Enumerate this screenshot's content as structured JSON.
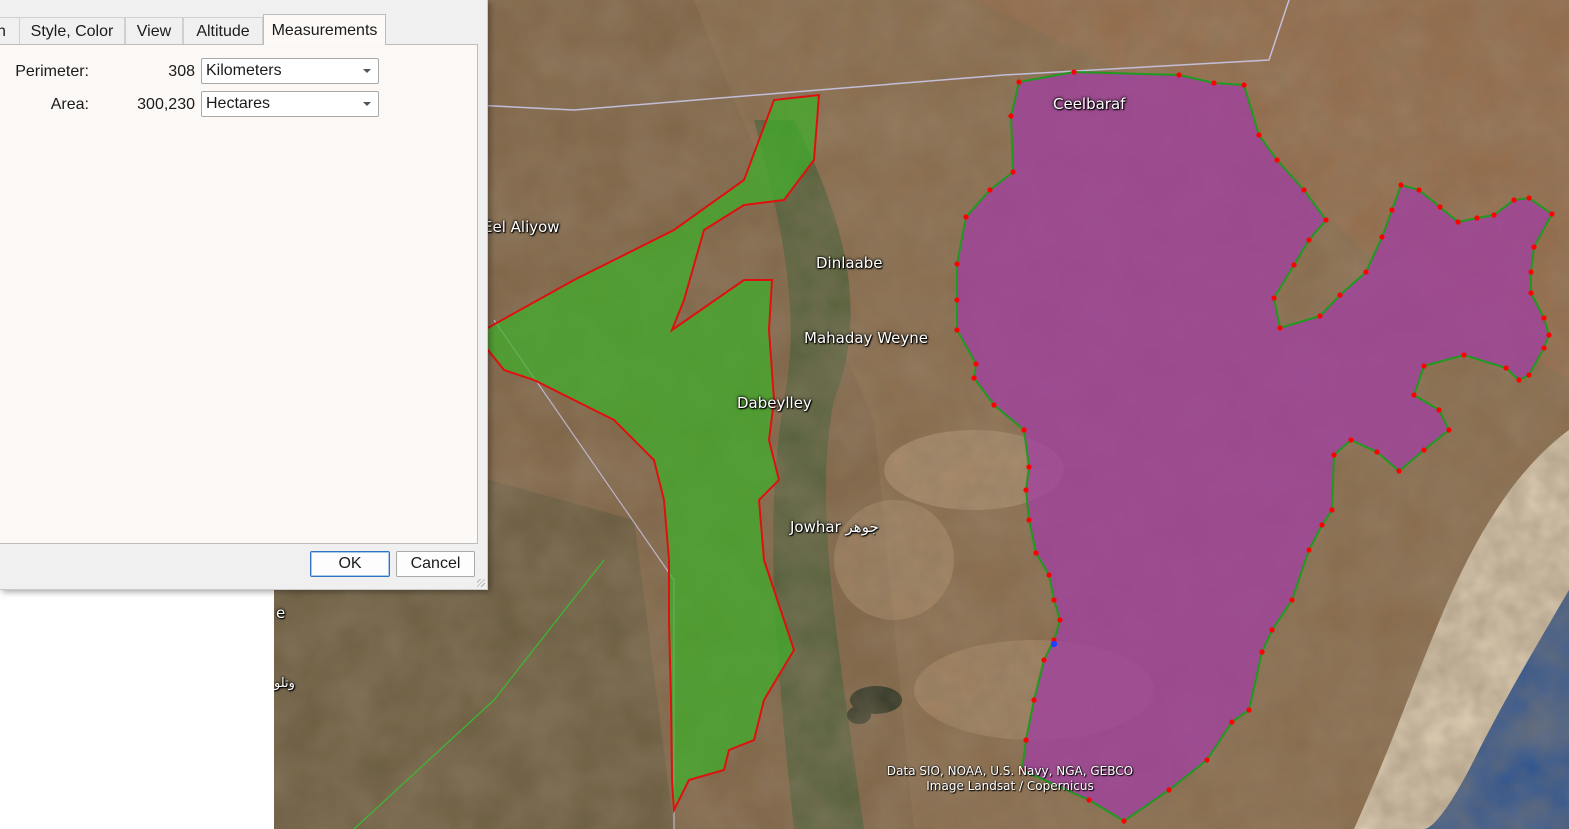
{
  "dialog": {
    "tabs": [
      {
        "label": "n"
      },
      {
        "label": "Style, Color"
      },
      {
        "label": "View"
      },
      {
        "label": "Altitude"
      },
      {
        "label": "Measurements",
        "active": true
      }
    ],
    "perimeter": {
      "label": "Perimeter:",
      "value": "308",
      "unit": "Kilometers"
    },
    "area": {
      "label": "Area:",
      "value": "300,230",
      "unit": "Hectares"
    },
    "ok_label": "OK",
    "cancel_label": "Cancel"
  },
  "map": {
    "labels": [
      {
        "id": "ceelbaraf",
        "text": "Ceelbaraf"
      },
      {
        "id": "eel-aliyow",
        "text": "Eel Aliyow"
      },
      {
        "id": "dinlaabe",
        "text": "Dinlaabe"
      },
      {
        "id": "mahaday-weyne",
        "text": "Mahaday Weyne"
      },
      {
        "id": "dabeylley",
        "text": "Dabeylley"
      },
      {
        "id": "jowhar",
        "text": "Jowhar جوهر"
      },
      {
        "id": "left-fragment-e",
        "text": "e"
      },
      {
        "id": "left-fragment-arabic",
        "text": "وتلو"
      }
    ],
    "attribution": {
      "line1": "Data SIO, NOAA, U.S. Navy, NGA, GEBCO",
      "line2": "Image Landsat / Copernicus"
    },
    "colors": {
      "terrain": "#8a6a48",
      "green_polygon_fill": "#3fae2a",
      "green_polygon_stroke": "#e01010",
      "purple_polygon_fill": "#a0409f",
      "purple_polygon_stroke": "#1f9a1f",
      "vertex": "#ff0000",
      "selected_vertex": "#2040ff",
      "ocean": "#1f4f9a",
      "beach": "#e7d7bd"
    }
  }
}
